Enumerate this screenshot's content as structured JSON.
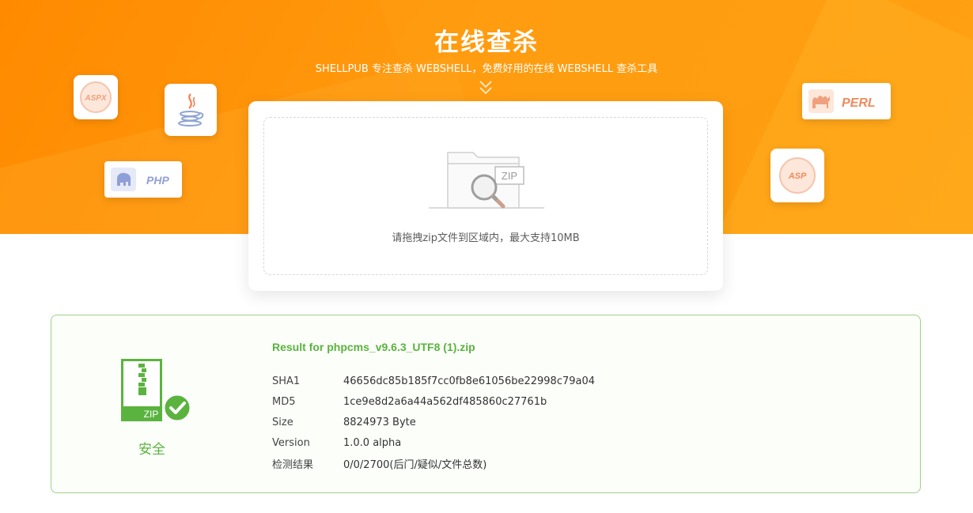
{
  "hero": {
    "title": "在线查杀",
    "subtitle": "SHELLPUB 专注查杀 WEBSHELL，免费好用的在线 WEBSHELL 查杀工具",
    "accent_color": "#ff8a00"
  },
  "badges": {
    "aspx": {
      "text": "ASPX",
      "icon": "aspx-badge-icon"
    },
    "java": {
      "icon": "java-coffee-icon"
    },
    "php": {
      "text": "PHP",
      "icon": "php-elephant-icon"
    },
    "perl": {
      "text": "PERL",
      "icon": "perl-camel-icon"
    },
    "asp": {
      "text": "ASP",
      "icon": "asp-badge-icon"
    }
  },
  "upload": {
    "illustration_label": "ZIP",
    "hint": "请拖拽zip文件到区域内，最大支持10MB"
  },
  "result": {
    "title": "Result for phpcms_v9.6.3_UTF8 (1).zip",
    "status_label": "安全",
    "zip_icon_label": "ZIP",
    "status_color": "#5bb33f",
    "rows": [
      {
        "label": "SHA1",
        "value": "46656dc85b185f7cc0fb8e61056be22998c79a04"
      },
      {
        "label": "MD5",
        "value": "1ce9e8d2a6a44a562df485860c27761b"
      },
      {
        "label": "Size",
        "value": "8824973 Byte"
      },
      {
        "label": "Version",
        "value": "1.0.0 alpha"
      },
      {
        "label": "检测结果",
        "value": "0/0/2700(后门/疑似/文件总数)"
      }
    ]
  }
}
